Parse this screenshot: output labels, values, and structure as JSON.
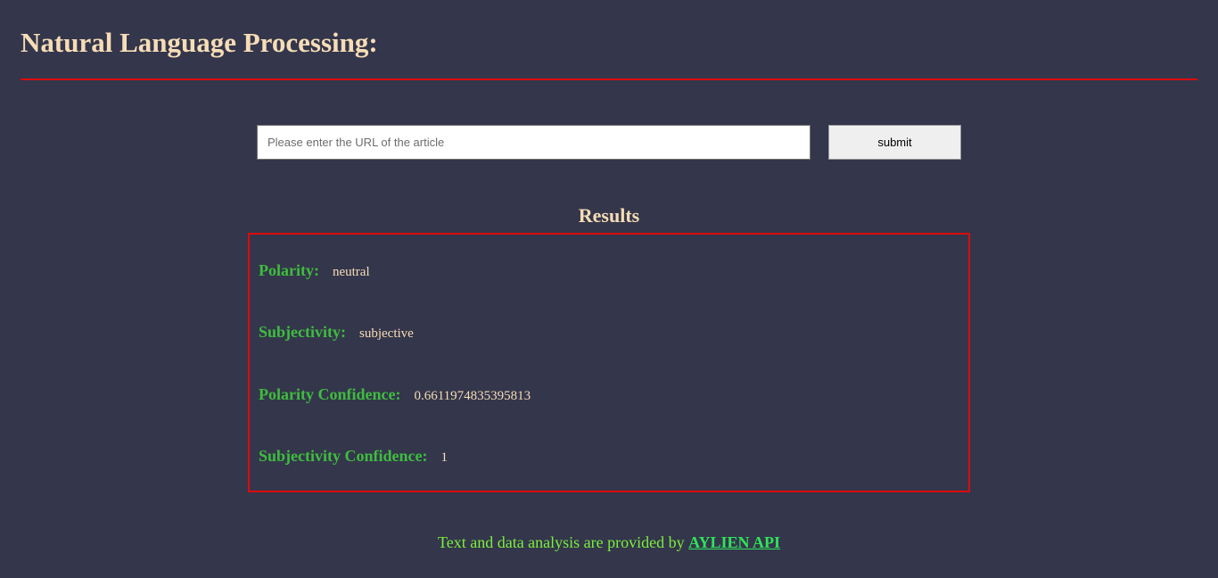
{
  "header": {
    "title": "Natural Language Processing:"
  },
  "form": {
    "url_placeholder": "Please enter the URL of the article",
    "url_value": "",
    "submit_label": "submit"
  },
  "results": {
    "heading": "Results",
    "items": [
      {
        "label": "Polarity:",
        "value": "neutral"
      },
      {
        "label": "Subjectivity:",
        "value": "subjective"
      },
      {
        "label": "Polarity Confidence:",
        "value": "0.6611974835395813"
      },
      {
        "label": "Subjectivity Confidence:",
        "value": "1"
      }
    ]
  },
  "footer": {
    "text": "Text and data analysis are provided by",
    "link_label": "AYLIEN API"
  },
  "colors": {
    "background": "#34364b",
    "title": "#f6ddb6",
    "accent_red": "#dc0b0b",
    "label_green": "#3ebd3e",
    "footer_text": "#7af03c",
    "footer_link": "#2fe35a"
  }
}
